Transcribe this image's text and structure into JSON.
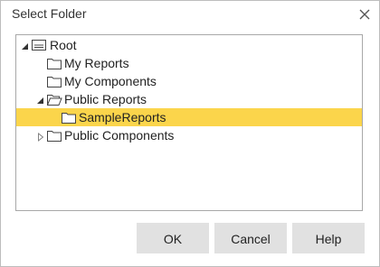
{
  "dialog": {
    "title": "Select Folder",
    "close_icon": "close-icon"
  },
  "tree": {
    "root": {
      "label": "Root",
      "expanded": true,
      "icon": "server-root-icon"
    },
    "items": [
      {
        "label": "My Reports",
        "icon": "folder-icon",
        "expanded": false,
        "has_children": false,
        "selected": false
      },
      {
        "label": "My Components",
        "icon": "folder-icon",
        "expanded": false,
        "has_children": false,
        "selected": false
      },
      {
        "label": "Public Reports",
        "icon": "folder-open-icon",
        "expanded": true,
        "has_children": true,
        "selected": false
      },
      {
        "label": "SampleReports",
        "icon": "folder-icon",
        "expanded": false,
        "has_children": false,
        "selected": true
      },
      {
        "label": "Public Components",
        "icon": "folder-icon",
        "expanded": false,
        "has_children": true,
        "selected": false
      }
    ]
  },
  "buttons": {
    "ok": "OK",
    "cancel": "Cancel",
    "help": "Help"
  },
  "colors": {
    "selection": "#fbd54b",
    "button_bg": "#e1e1e1",
    "panel_border": "#a8a8a8"
  }
}
